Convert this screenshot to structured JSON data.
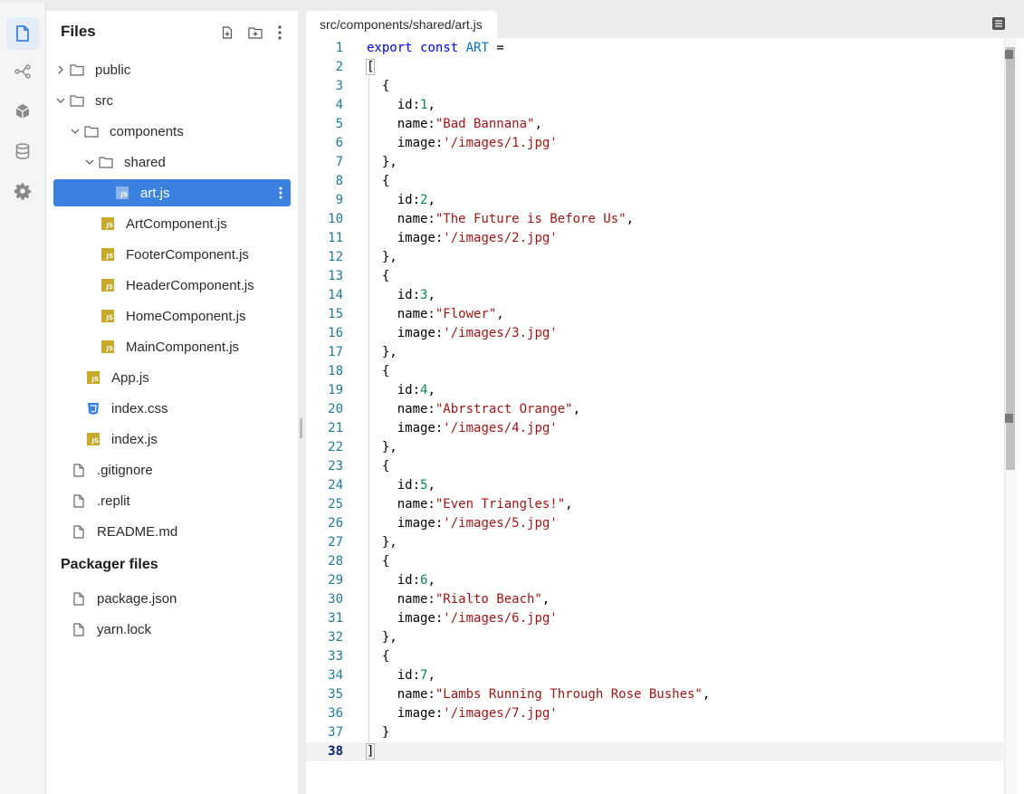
{
  "sidebar": {
    "title": "Files",
    "tree": [
      {
        "label": "public",
        "kind": "folder",
        "state": "collapsed"
      },
      {
        "label": "src",
        "kind": "folder",
        "state": "expanded"
      },
      {
        "label": "components",
        "kind": "folder",
        "state": "expanded"
      },
      {
        "label": "shared",
        "kind": "folder",
        "state": "expanded"
      },
      {
        "label": "art.js",
        "kind": "js",
        "selected": true
      },
      {
        "label": "ArtComponent.js",
        "kind": "js"
      },
      {
        "label": "FooterComponent.js",
        "kind": "js"
      },
      {
        "label": "HeaderComponent.js",
        "kind": "js"
      },
      {
        "label": "HomeComponent.js",
        "kind": "js"
      },
      {
        "label": "MainComponent.js",
        "kind": "js"
      },
      {
        "label": "App.js",
        "kind": "js"
      },
      {
        "label": "index.css",
        "kind": "css"
      },
      {
        "label": "index.js",
        "kind": "js"
      },
      {
        "label": ".gitignore",
        "kind": "file"
      },
      {
        "label": ".replit",
        "kind": "file"
      },
      {
        "label": "README.md",
        "kind": "file"
      }
    ],
    "packager_title": "Packager files",
    "packager": [
      {
        "label": "package.json",
        "kind": "file"
      },
      {
        "label": "yarn.lock",
        "kind": "file"
      }
    ]
  },
  "editor": {
    "tab_label": "src/components/shared/art.js",
    "current_line": 38,
    "lines": [
      "export const ART =",
      "[",
      "  {",
      "    id:1,",
      "    name:\"Bad Bannana\",",
      "    image:'/images/1.jpg'",
      "  },",
      "  {",
      "    id:2,",
      "    name:\"The Future is Before Us\",",
      "    image:'/images/2.jpg'",
      "  },",
      "  {",
      "    id:3,",
      "    name:\"Flower\",",
      "    image:'/images/3.jpg'",
      "  },",
      "  {",
      "    id:4,",
      "    name:\"Abrstract Orange\",",
      "    image:'/images/4.jpg'",
      "  },",
      "  {",
      "    id:5,",
      "    name:\"Even Triangles!\",",
      "    image:'/images/5.jpg'",
      "  },",
      "  {",
      "    id:6,",
      "    name:\"Rialto Beach\",",
      "    image:'/images/6.jpg'",
      "  },",
      "  {",
      "    id:7,",
      "    name:\"Lambs Running Through Rose Bushes\",",
      "    image:'/images/7.jpg'",
      "  }",
      "]"
    ]
  },
  "colors": {
    "selection": "#3b82e0",
    "js_icon": "#c7a92b",
    "css_icon": "#3b82e0",
    "keyword": "#0000ff",
    "string": "#a31515",
    "number": "#098658",
    "line_number": "#237893"
  }
}
